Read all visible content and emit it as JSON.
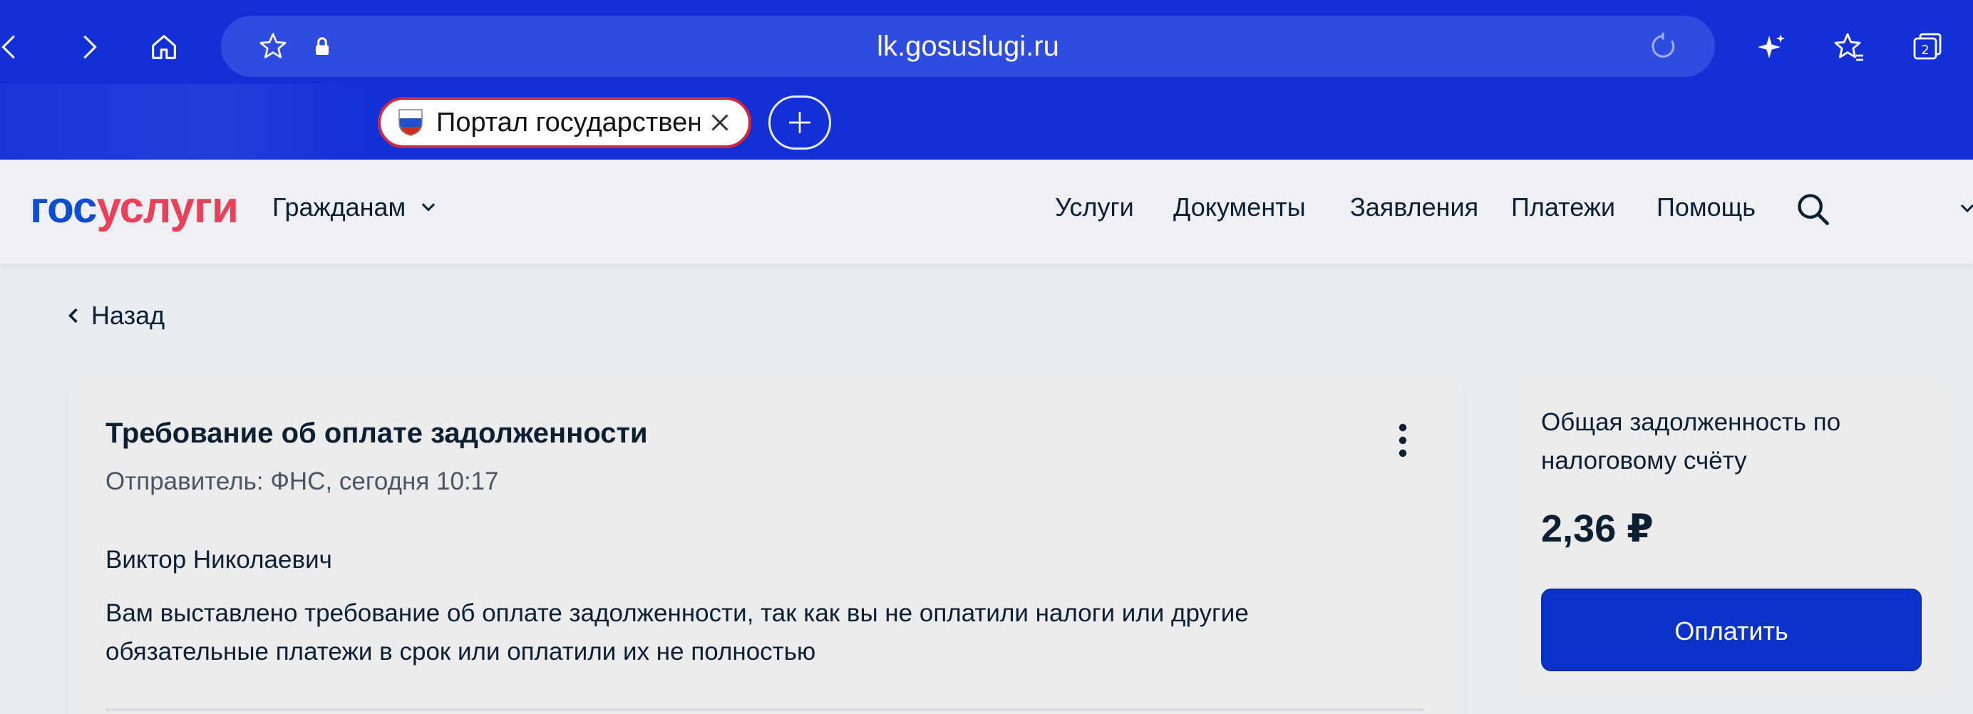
{
  "browser": {
    "url": "lk.gosuslugi.ru",
    "tab_title": "Портал государствен...",
    "tab_count": "2",
    "colors": {
      "chrome": "#1330d6",
      "urlbar": "#2e4ce0",
      "tab_border": "#d4263a"
    },
    "icons": [
      "back-icon",
      "forward-icon",
      "home-icon",
      "star-icon",
      "lock-icon",
      "reload-icon",
      "sparkle-icon",
      "favorites-icon",
      "tabs-icon",
      "close-icon",
      "plus-icon"
    ]
  },
  "site": {
    "logo_gos": "гос",
    "logo_uslugi": "услуги",
    "audience": "Гражданам",
    "menu": [
      "Услуги",
      "Документы",
      "Заявления",
      "Платежи",
      "Помощь"
    ],
    "colors": {
      "brand_blue": "#0d4cd3",
      "brand_red": "#ee3f58",
      "button": "#0b33cc"
    }
  },
  "page": {
    "back_label": "Назад",
    "notice": {
      "title": "Требование об оплате задолженности",
      "sender": "Отправитель: ФНС, сегодня 10:17",
      "greeting": "Виктор Николаевич",
      "body": "Вам выставлено требование об оплате задолженности, так как вы не оплатили налоги или другие обязательные платежи в срок или оплатили их не полностью"
    },
    "summary": {
      "label": "Общая задолженность по налоговому счёту",
      "amount": "2,36 ₽",
      "pay_button": "Оплатить"
    }
  }
}
